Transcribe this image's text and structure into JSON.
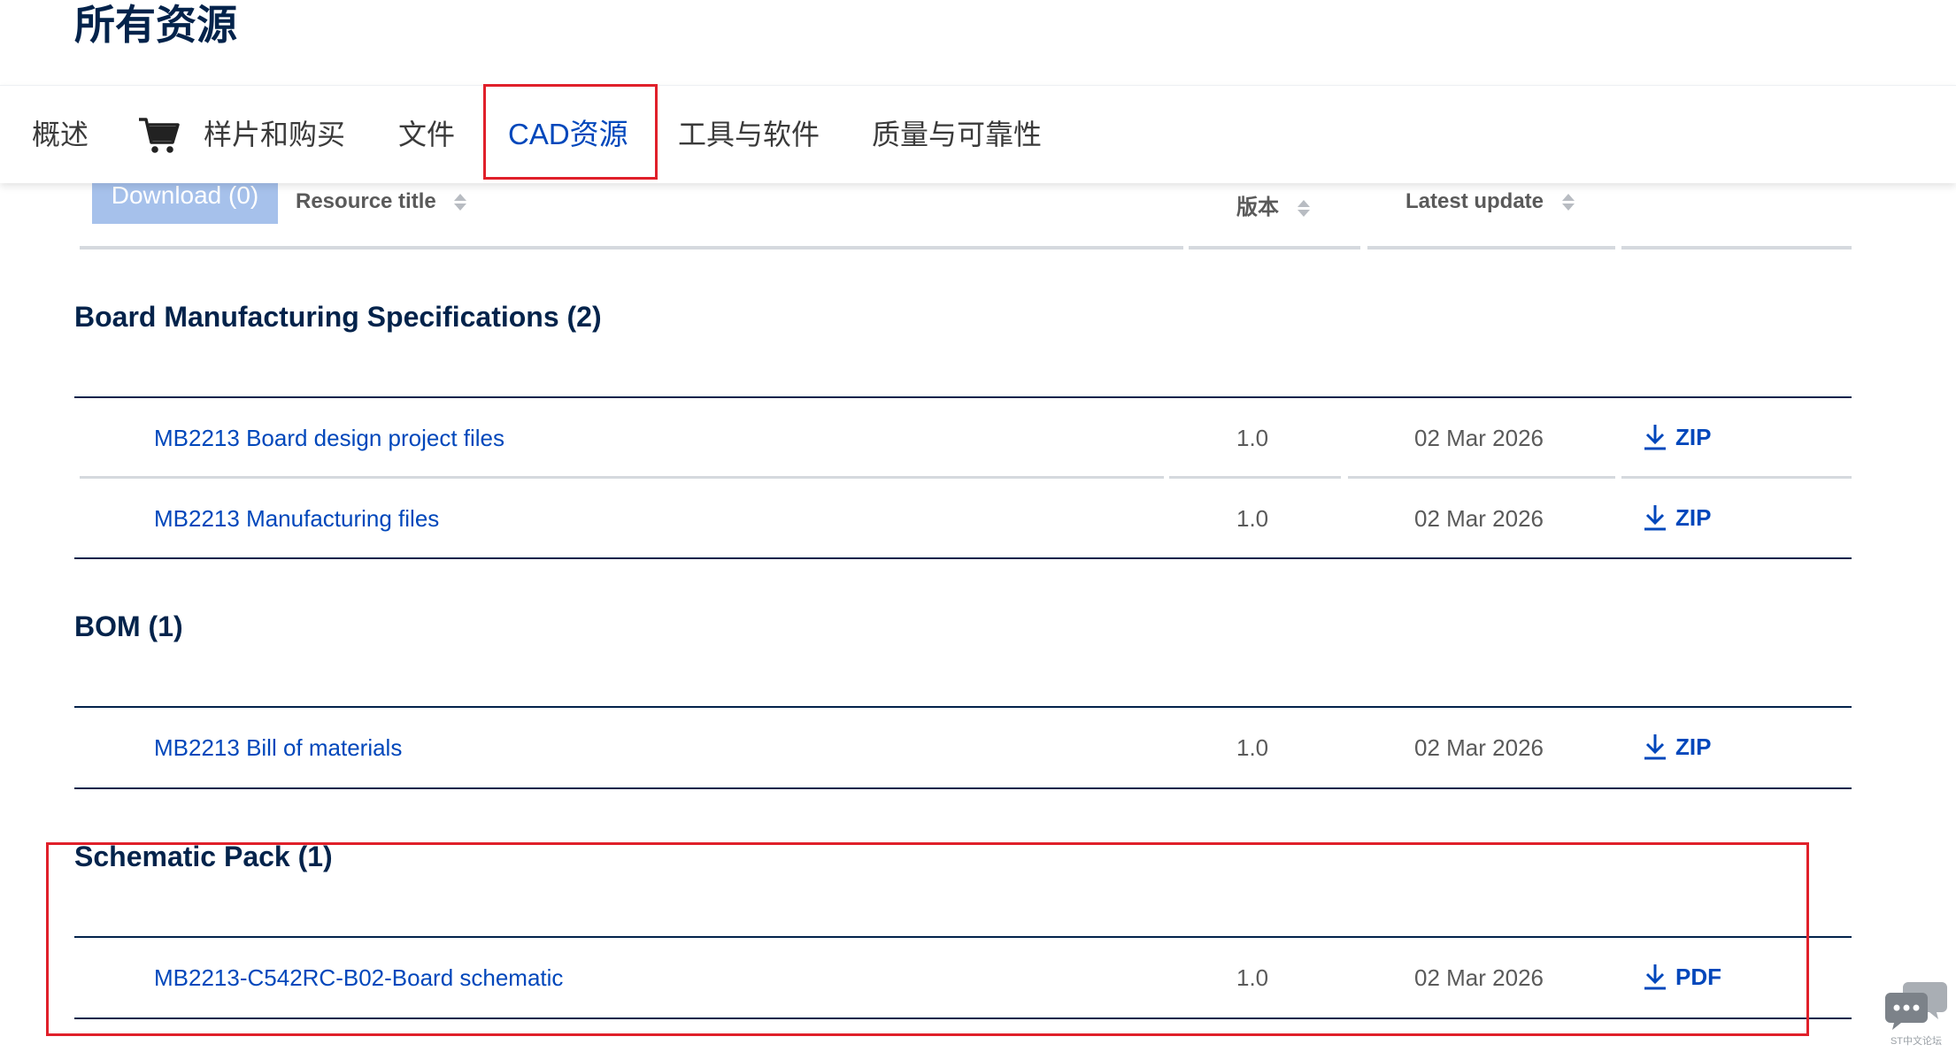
{
  "page": {
    "title": "所有资源"
  },
  "tabs": [
    {
      "label": "概述"
    },
    {
      "label": "样片和购买",
      "icon": "cart-icon"
    },
    {
      "label": "文件"
    },
    {
      "label": "CAD资源",
      "active": true
    },
    {
      "label": "工具与软件"
    },
    {
      "label": "质量与可靠性"
    }
  ],
  "table": {
    "download_button": "Download (0)",
    "columns": {
      "title": "Resource title",
      "version": "版本",
      "updated": "Latest update"
    }
  },
  "sections": [
    {
      "title": "Board Manufacturing Specifications (2)",
      "rows": [
        {
          "name": "MB2213 Board design project files",
          "version": "1.0",
          "date": "02 Mar 2026",
          "format": "ZIP"
        },
        {
          "name": "MB2213 Manufacturing files",
          "version": "1.0",
          "date": "02 Mar 2026",
          "format": "ZIP"
        }
      ]
    },
    {
      "title": "BOM (1)",
      "rows": [
        {
          "name": "MB2213 Bill of materials",
          "version": "1.0",
          "date": "02 Mar 2026",
          "format": "ZIP"
        }
      ]
    },
    {
      "title": "Schematic Pack (1)",
      "rows": [
        {
          "name": "MB2213-C542RC-B02-Board schematic",
          "version": "1.0",
          "date": "02 Mar 2026",
          "format": "PDF"
        }
      ]
    }
  ],
  "watermark": {
    "label": "ST中文论坛"
  },
  "colors": {
    "brand": "#03234b",
    "link": "#0047bb",
    "highlight": "#e0202a"
  }
}
